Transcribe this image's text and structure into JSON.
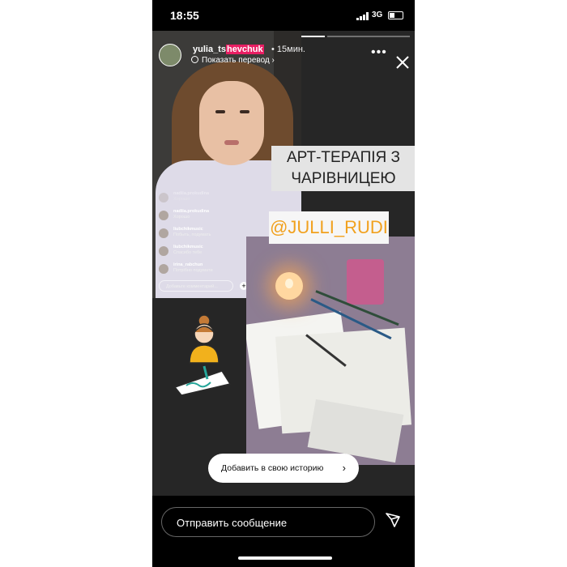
{
  "status_bar": {
    "time": "18:55",
    "network": "3G"
  },
  "story": {
    "username_prefix": "yulia_ts",
    "username_highlight": "hevchuk",
    "time_ago": "• 15мин.",
    "translate_label": "Показать перевод",
    "title_text": "АРТ-ТЕРАПІЯ З ЧАРІВНИЦЕЮ",
    "mention_tag": "@JULLI_RUDI",
    "add_to_story": "Добавить в свою историю"
  },
  "live_chat": {
    "comments": [
      {
        "user": "nadiia.prokudina",
        "text": "Хорошо"
      },
      {
        "user": "liubchikmusic",
        "text": "Побыть, подумать"
      },
      {
        "user": "liubchikmusic",
        "text": "Спасибо тебе"
      },
      {
        "user": "irina_rabchun",
        "text": "Потрібно подумати"
      }
    ],
    "input_placeholder": "Добавьте комментарий..."
  },
  "reply": {
    "placeholder": "Отправить сообщение"
  },
  "colors": {
    "story_bg": "#262626",
    "highlight": "#e91e63",
    "tag_text": "#f1a11e"
  },
  "icons": [
    "signal-icon",
    "battery-icon",
    "globe-icon",
    "more-icon",
    "close-icon",
    "chevron-right-icon",
    "send-icon"
  ]
}
